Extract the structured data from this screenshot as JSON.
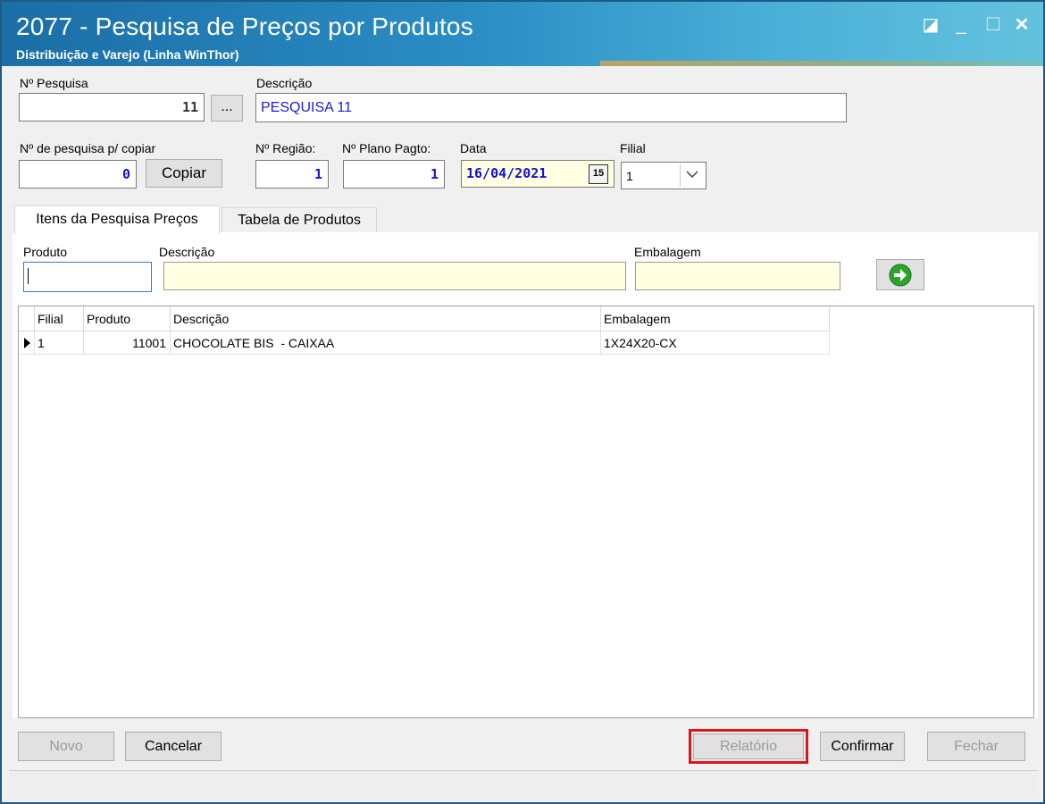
{
  "window": {
    "title": "2077 - Pesquisa de Preços por Produtos",
    "subtitle": "Distribuição e Varejo (Linha WinThor)",
    "controls": {
      "restore": "◪",
      "minimize": "_",
      "maximize": "☐",
      "close": "✕"
    }
  },
  "form": {
    "pesquisa_label": "Nº Pesquisa",
    "pesquisa_value": "11",
    "browse_label": "...",
    "descricao_label": "Descrição",
    "descricao_value": "PESQUISA 11",
    "copiar_label": "Nº de pesquisa p/ copiar",
    "copiar_value": "0",
    "copiar_button": "Copiar",
    "regiao_label": "Nº Região:",
    "regiao_value": "1",
    "plano_label": "Nº Plano Pagto:",
    "plano_value": "1",
    "data_label": "Data",
    "data_value": "16/04/2021",
    "calendar_icon_text": "15",
    "filial_label": "Filial",
    "filial_value": "1"
  },
  "tabs": [
    {
      "label": "Itens da Pesquisa Preços",
      "active": true
    },
    {
      "label": "Tabela de Produtos",
      "active": false
    }
  ],
  "filter": {
    "produto_label": "Produto",
    "produto_value": "",
    "descricao_label": "Descrição",
    "descricao_value": "",
    "embalagem_label": "Embalagem",
    "embalagem_value": "",
    "go_icon": "arrow-right-icon"
  },
  "grid": {
    "columns": [
      "Filial",
      "Produto",
      "Descrição",
      "Embalagem"
    ],
    "rows": [
      {
        "filial": "1",
        "produto": "11001",
        "descricao": "CHOCOLATE BIS  - CAIXAA",
        "embalagem": "1X24X20-CX"
      }
    ]
  },
  "buttons": {
    "novo": "Novo",
    "cancelar": "Cancelar",
    "relatorio": "Relatório",
    "confirmar": "Confirmar",
    "fechar": "Fechar"
  },
  "colors": {
    "title_gradient_start": "#1b6ea6",
    "highlight_box": "#e0151b",
    "input_value": "#1010d0",
    "readonly_field": "#ffffe1"
  }
}
